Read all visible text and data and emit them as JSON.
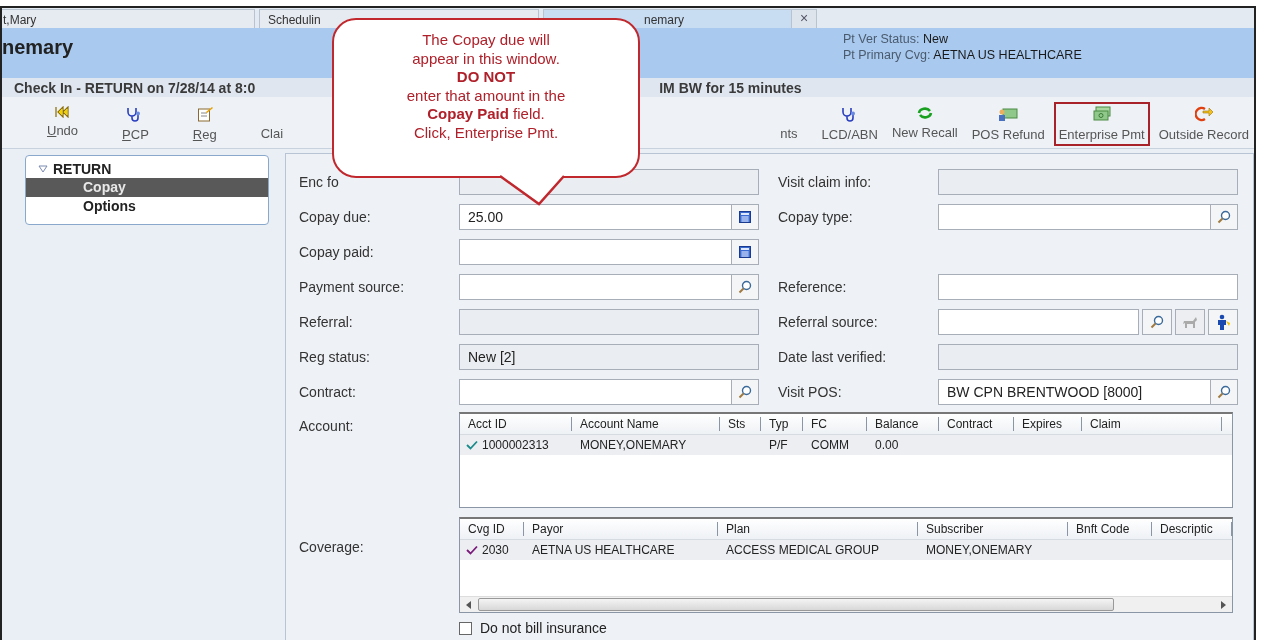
{
  "tabs": [
    {
      "label": "t,Mary",
      "selected": false
    },
    {
      "label": "Schedulin",
      "selected": false
    },
    {
      "label": "nemary",
      "selected": true
    }
  ],
  "tab_close": "×",
  "header": {
    "patient": "nemary",
    "status": [
      {
        "label": "Pt Ver Status:",
        "value": "New"
      },
      {
        "label": "Pt Primary Cvg:",
        "value": "AETNA US HEALTHCARE"
      }
    ]
  },
  "title_bar": [
    "Check In - RETURN on 7/28/14 at 8:0",
    "IM BW for 15 minutes"
  ],
  "toolbar": [
    {
      "label": "Undo",
      "mnemonic": true,
      "highlighted": false
    },
    {
      "label": "PCP",
      "mnemonic": true,
      "highlighted": false
    },
    {
      "label": "Reg",
      "mnemonic": true,
      "highlighted": false
    },
    {
      "label": "Clai",
      "mnemonic": false,
      "highlighted": false
    },
    {
      "label": "nts",
      "mnemonic": false,
      "highlighted": false
    },
    {
      "label": "LCD/ABN",
      "mnemonic": false,
      "highlighted": false
    },
    {
      "label": "New Recall",
      "mnemonic": false,
      "highlighted": false
    },
    {
      "label": "POS Refund",
      "mnemonic": false,
      "highlighted": false
    },
    {
      "label": "Enterprise Pmt",
      "mnemonic": false,
      "highlighted": true
    },
    {
      "label": "Outside Record",
      "mnemonic": false,
      "highlighted": false
    }
  ],
  "sidebar": {
    "label": "RETURN",
    "expanded": true,
    "children": [
      {
        "label": "Copay",
        "selected": true
      },
      {
        "label": "Options",
        "selected": false
      }
    ]
  },
  "form_rows": [
    {
      "left": {
        "label": "Enc fo",
        "kind": "readonly"
      },
      "right": {
        "label": "Visit claim info:",
        "kind": "readonly"
      }
    },
    {
      "left": {
        "label": "Copay due:",
        "kind": "calc",
        "value": "25.00"
      },
      "right": {
        "label": "Copay type:",
        "kind": "lookup"
      }
    },
    {
      "left": {
        "label": "Copay paid:",
        "kind": "calc"
      }
    },
    {
      "left": {
        "label": "Payment source:",
        "kind": "lookup"
      },
      "right": {
        "label": "Reference:",
        "kind": "text"
      }
    },
    {
      "left": {
        "label": "Referral:",
        "kind": "readonly"
      },
      "right": {
        "label": "Referral source:",
        "kind": "referral"
      }
    },
    {
      "left": {
        "label": "Reg status:",
        "kind": "readonly",
        "value": "New [2]"
      },
      "right": {
        "label": "Date last verified:",
        "kind": "readonly"
      }
    },
    {
      "left": {
        "label": "Contract:",
        "kind": "lookup"
      },
      "right": {
        "label": "Visit POS:",
        "kind": "lookup",
        "value": "BW CPN BRENTWOOD [8000]"
      }
    }
  ],
  "account": {
    "label": "Account:",
    "columns": [
      "Acct ID",
      "Account Name",
      "Sts",
      "Typ",
      "FC",
      "Balance",
      "Contract",
      "Expires",
      "Claim"
    ],
    "rows": [
      {
        "checked": true,
        "cells": [
          "1000002313",
          "MONEY,ONEMARY",
          null,
          "P/F",
          "COMM",
          "0.00"
        ]
      }
    ]
  },
  "coverage": {
    "label": "Coverage:",
    "columns": [
      "Cvg ID",
      "Payor",
      "Plan",
      "Subscriber",
      "Bnft Code",
      "Descriptic"
    ],
    "rows": [
      {
        "checked": true,
        "cells": [
          "2030",
          "AETNA US HEALTHCARE",
          "ACCESS MEDICAL GROUP",
          "MONEY,ONEMARY"
        ]
      }
    ]
  },
  "do_not_bill": {
    "label": "Do not bill insurance",
    "checked": false
  },
  "callout": {
    "lines": [
      "The Copay due will",
      "appear in this window.",
      "**DO NOT**",
      "enter that amount in the",
      "**Copay Paid** field.",
      "Click, Enterprise Pmt."
    ]
  }
}
